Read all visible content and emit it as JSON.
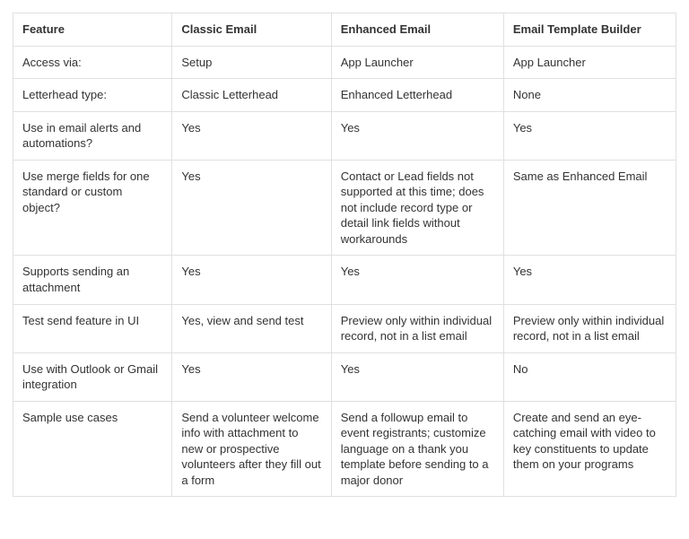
{
  "table": {
    "headers": [
      "Feature",
      "Classic Email",
      "Enhanced Email",
      "Email Template Builder"
    ],
    "rows": [
      [
        "Access via:",
        "Setup",
        "App Launcher",
        "App Launcher"
      ],
      [
        "Letterhead type:",
        "Classic Letterhead",
        "Enhanced Letterhead",
        "None"
      ],
      [
        "Use in email alerts and automations?",
        "Yes",
        "Yes",
        "Yes"
      ],
      [
        "Use merge fields for one standard or custom object?",
        "Yes",
        "Contact or Lead fields not supported at this time; does not include record type or detail link fields without workarounds",
        "Same as Enhanced Email"
      ],
      [
        "Supports sending an attachment",
        "Yes",
        "Yes",
        "Yes"
      ],
      [
        "Test send feature in UI",
        "Yes, view and send test",
        "Preview only within individual record, not in a list email",
        "Preview only within individual record, not in a list email"
      ],
      [
        "Use with Outlook or Gmail integration",
        "Yes",
        "Yes",
        "No"
      ],
      [
        "Sample use cases",
        "Send a volunteer welcome info with attachment to new or prospective volunteers after they fill out a form",
        "Send a followup email to event registrants; customize language  on a thank you template before sending to a major donor",
        "Create and send an eye-catching email with video to key constituents to update them on your programs"
      ]
    ]
  }
}
